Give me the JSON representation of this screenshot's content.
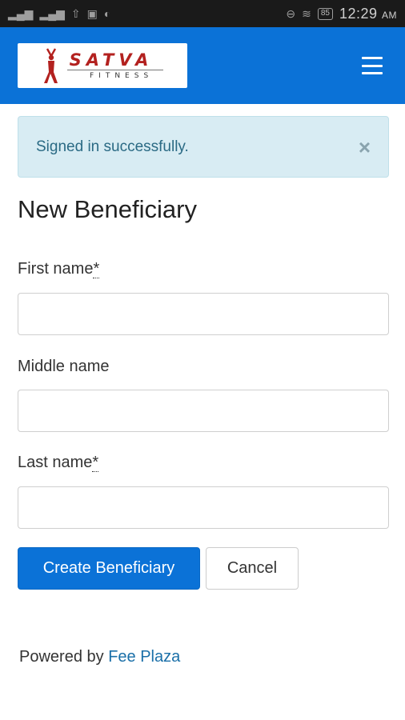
{
  "status_bar": {
    "signal_icons": [
      "signal-icon",
      "signal-icon",
      "upload-icon",
      "image-icon",
      "sync-icon"
    ],
    "right_icons": [
      "dnd-icon",
      "wifi-icon"
    ],
    "battery": "85",
    "time": "12:29",
    "ampm": "AM"
  },
  "navbar": {
    "logo_text": "SATVA",
    "logo_subtext": "FITNESS",
    "menu_icon": "hamburger-icon"
  },
  "alert": {
    "message": "Signed in successfully.",
    "close": "×"
  },
  "page": {
    "title": "New Beneficiary"
  },
  "form": {
    "first_name_label": "First name",
    "middle_name_label": "Middle name",
    "last_name_label": "Last name",
    "required_mark": "*",
    "first_name_value": "",
    "middle_name_value": "",
    "last_name_value": "",
    "submit_label": "Create Beneficiary",
    "cancel_label": "Cancel"
  },
  "footer": {
    "prefix": "Powered by",
    "link_text": "Fee Plaza"
  },
  "colors": {
    "primary": "#0b72d7",
    "alert_bg": "#d8ecf3",
    "alert_text": "#2a6a84",
    "logo_red": "#b3211f"
  }
}
